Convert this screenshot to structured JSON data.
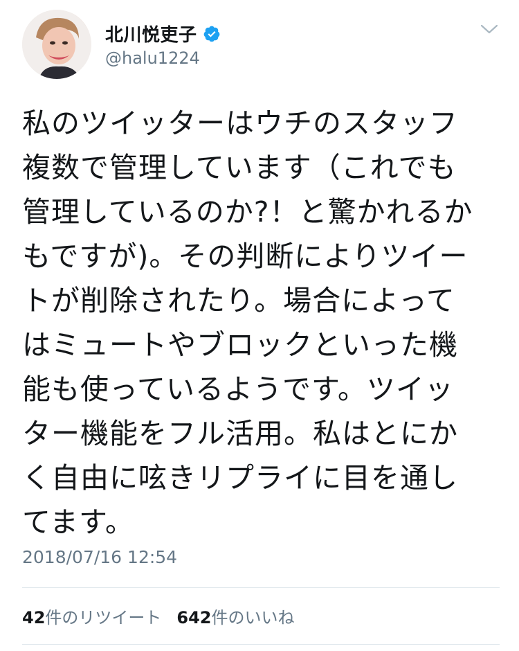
{
  "author": {
    "display_name": "北川悦吏子",
    "handle": "@halu1224",
    "verified": true
  },
  "tweet": {
    "text": "私のツイッターはウチのスタッフ\n複数で管理しています（これでも\n管理しているのか?！と驚かれるか\nもですが)。その判断によりツイー\nトが削除されたり。場合によって\nはミュートやブロックといった機\n能も使っているようです。ツイッ\nター機能をフル活用。私はとにか\nく自由に呟きリプライに目を通し\nてます。",
    "timestamp": "2018/07/16 12:54"
  },
  "stats": {
    "retweets_count": "42",
    "retweets_label": "件のリツイート",
    "likes_count": "642",
    "likes_label": "件のいいね"
  },
  "icons": {
    "verified": "verified-badge-icon",
    "menu": "chevron-down-icon"
  },
  "colors": {
    "verified_blue": "#1da1f2",
    "secondary_text": "#657786",
    "primary_text": "#14171a",
    "divider": "#e1e8ed"
  }
}
